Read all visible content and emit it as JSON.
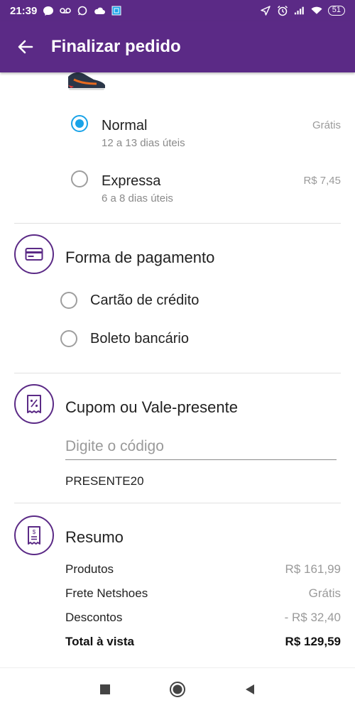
{
  "status_bar": {
    "time": "21:39",
    "battery": "51",
    "icons": [
      "messenger-icon",
      "voicemail-icon",
      "whatsapp-icon",
      "cloud-icon",
      "app-icon",
      "location-icon",
      "alarm-icon",
      "signal-icon",
      "wifi-icon"
    ]
  },
  "app_bar": {
    "title": "Finalizar pedido",
    "back_icon": "arrow-back-icon"
  },
  "shipping": {
    "options": [
      {
        "name": "Normal",
        "eta": "12 a 13 dias úteis",
        "price": "Grátis",
        "selected": true
      },
      {
        "name": "Expressa",
        "eta": "6 a 8 dias úteis",
        "price": "R$ 7,45",
        "selected": false
      }
    ]
  },
  "payment": {
    "title": "Forma de pagamento",
    "icon": "credit-card-icon",
    "options": [
      {
        "label": "Cartão de crédito",
        "selected": false
      },
      {
        "label": "Boleto bancário",
        "selected": false
      }
    ]
  },
  "coupon": {
    "title": "Cupom ou Vale-presente",
    "icon": "coupon-icon",
    "placeholder": "Digite o código",
    "value": "",
    "applied_code": "PRESENTE20"
  },
  "summary": {
    "title": "Resumo",
    "icon": "receipt-icon",
    "rows": [
      {
        "label": "Produtos",
        "value": "R$ 161,99"
      },
      {
        "label": "Frete Netshoes",
        "value": "Grátis"
      },
      {
        "label": "Descontos",
        "value": "- R$ 32,40"
      }
    ],
    "total": {
      "label": "Total à vista",
      "value": "R$ 129,59"
    }
  },
  "colors": {
    "brand": "#5b2a86",
    "radio_selected": "#1aa3e8"
  },
  "nav_bar": {
    "icons": [
      "recent-apps-icon",
      "home-icon",
      "back-icon"
    ]
  }
}
